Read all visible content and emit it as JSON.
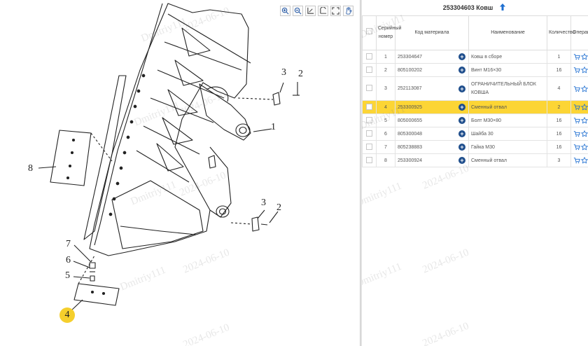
{
  "header": {
    "title": "253304603 Ковш"
  },
  "toolbar": {
    "tools": [
      "zoom-in-icon",
      "zoom-out-icon",
      "fit-page-icon",
      "fit-width-icon",
      "fullscreen-icon",
      "pan-icon"
    ]
  },
  "drawing": {
    "callouts": [
      "1",
      "2",
      "3",
      "2",
      "3",
      "4",
      "5",
      "6",
      "7",
      "8"
    ]
  },
  "watermark": {
    "name": "Dmitriy111",
    "date": "2024-06-10"
  },
  "table": {
    "columns": [
      "Серийный номер",
      "Код материала",
      "Наименование",
      "Количество",
      "Операция"
    ],
    "rows": [
      {
        "num": "1",
        "code": "253304647",
        "name": "Ковш в сборе",
        "qty": "1"
      },
      {
        "num": "2",
        "code": "805100202",
        "name": "Винт M16×30",
        "qty": "16"
      },
      {
        "num": "3",
        "code": "252113087",
        "name": "ОГРАНИЧИТЕЛЬНЫЙ БЛОК КОВША",
        "qty": "4"
      },
      {
        "num": "4",
        "code": "253300925",
        "name": "Сменный отвал",
        "qty": "2"
      },
      {
        "num": "5",
        "code": "805000655",
        "name": "Болт М30×80",
        "qty": "16"
      },
      {
        "num": "6",
        "code": "805300048",
        "name": "Шайба 30",
        "qty": "16"
      },
      {
        "num": "7",
        "code": "805238883",
        "name": "Гайка М30",
        "qty": "16"
      },
      {
        "num": "8",
        "code": "253300924",
        "name": "Сменный отвал",
        "qty": "3"
      }
    ],
    "selected_row": "4"
  },
  "colors": {
    "accent": "#1f4e8c",
    "highlight": "#fcd535"
  }
}
